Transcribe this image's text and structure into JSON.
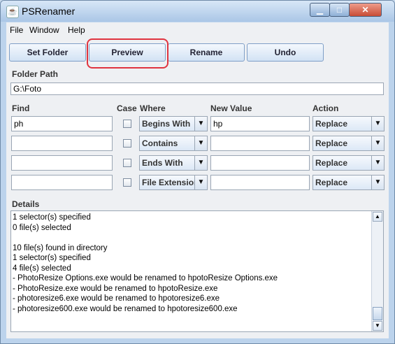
{
  "window": {
    "title": "PSRenamer",
    "min_glyph": "▁",
    "max_glyph": "□",
    "close_glyph": "✕"
  },
  "menu": [
    "File",
    "Window",
    "Help"
  ],
  "toolbar": {
    "set_folder": "Set Folder",
    "preview": "Preview",
    "rename": "Rename",
    "undo": "Undo"
  },
  "folder": {
    "label": "Folder Path",
    "value": "G:\\Foto"
  },
  "headers": {
    "find": "Find",
    "case": "Case",
    "where": "Where",
    "new_value": "New Value",
    "action": "Action"
  },
  "rows": [
    {
      "find": "ph",
      "where": "Begins With",
      "new_value": "hp",
      "action": "Replace"
    },
    {
      "find": "",
      "where": "Contains",
      "new_value": "",
      "action": "Replace"
    },
    {
      "find": "",
      "where": "Ends With",
      "new_value": "",
      "action": "Replace"
    },
    {
      "find": "",
      "where": "File Extension",
      "new_value": "",
      "action": "Replace"
    }
  ],
  "details": {
    "label": "Details",
    "lines": [
      "1 selector(s) specified",
      "0 file(s) selected",
      "",
      "10 file(s) found in directory",
      "1 selector(s) specified",
      "4 file(s) selected",
      "- PhotoResize Options.exe would be renamed to hpotoResize Options.exe",
      "- PhotoResize.exe would be renamed to hpotoResize.exe",
      "- photoresize6.exe would be renamed to hpotoresize6.exe",
      "- photoresize600.exe would be renamed to hpotoresize600.exe"
    ]
  },
  "colors": {
    "highlight": "#e0343f",
    "window_frame": "#bcd3ec"
  },
  "icons": {
    "dropdown": "▼",
    "scroll_up": "▲",
    "scroll_down": "▼"
  }
}
